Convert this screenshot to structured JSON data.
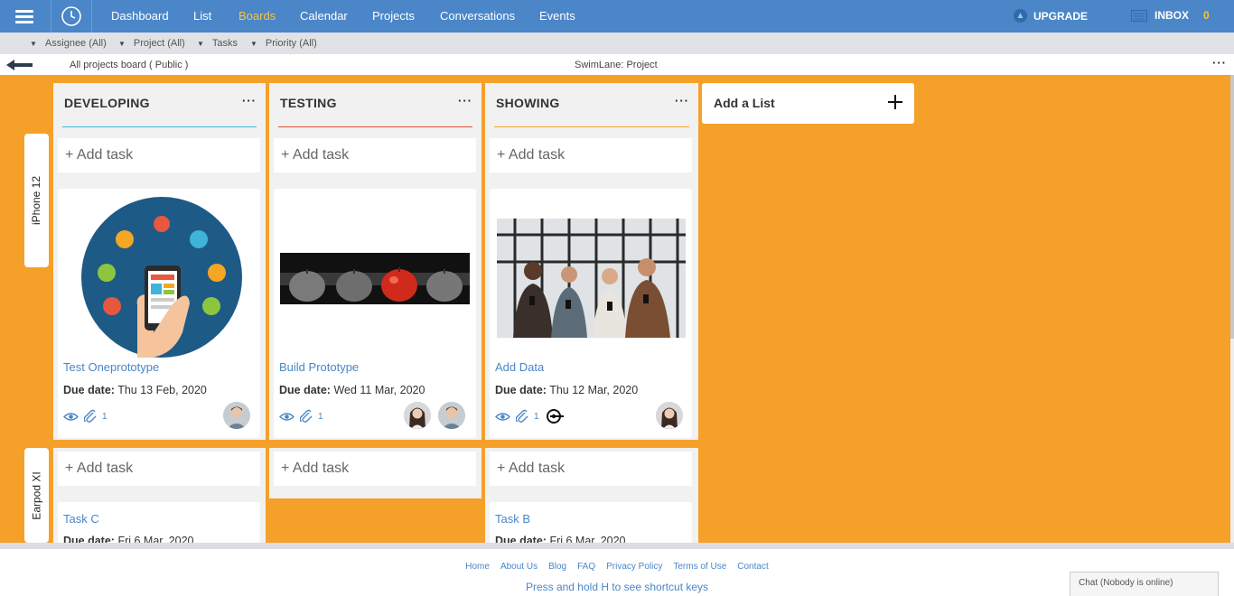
{
  "nav": {
    "items": [
      {
        "label": "Dashboard",
        "active": false
      },
      {
        "label": "List",
        "active": false
      },
      {
        "label": "Boards",
        "active": true
      },
      {
        "label": "Calendar",
        "active": false
      },
      {
        "label": "Projects",
        "active": false
      },
      {
        "label": "Conversations",
        "active": false
      },
      {
        "label": "Events",
        "active": false
      }
    ],
    "upgrade_label": "UPGRADE",
    "inbox_label": "INBOX",
    "inbox_count": "0",
    "accent_color": "#4a86c8",
    "active_color": "#f5c542"
  },
  "filters": [
    "Assignee (All)",
    "Project (All)",
    "Tasks",
    "Priority (All)"
  ],
  "board": {
    "title": "All projects board ( Public )",
    "swimlane_label": "SwimLane: Project",
    "more_label": "···",
    "background_color": "#f5a029"
  },
  "lanes": [
    "iPhone 12",
    "Earpod XI"
  ],
  "columns": [
    {
      "title": "DEVELOPING",
      "more": "···",
      "line_color": "#3fb3d8"
    },
    {
      "title": "TESTING",
      "more": "···",
      "line_color": "#d9533a"
    },
    {
      "title": "SHOWING",
      "more": "···",
      "line_color": "#f2a928"
    }
  ],
  "add_task_label": "+ Add task",
  "cards_lane1": [
    {
      "name": "Test Oneprototype",
      "due_label": "Due date:",
      "due_value": "Thu 13 Feb, 2020",
      "attachments": "1",
      "image": "mobile-apps-illustration"
    },
    {
      "name": "Build Prototype",
      "due_label": "Due date:",
      "due_value": "Wed 11 Mar, 2020",
      "attachments": "1",
      "image": "apples-photo"
    },
    {
      "name": "Add Data",
      "due_label": "Due date:",
      "due_value": "Thu 12 Mar, 2020",
      "attachments": "1",
      "image": "people-with-phones-photo"
    }
  ],
  "cards_lane2": [
    {
      "name": "Task C",
      "due_label": "Due date:",
      "due_value": "Fri 6 Mar, 2020"
    },
    {
      "name": "Task B",
      "due_label": "Due date:",
      "due_value": "Fri 6 Mar, 2020"
    }
  ],
  "add_list_label": "Add a List",
  "footer": {
    "links": [
      "Home",
      "About Us",
      "Blog",
      "FAQ",
      "Privacy Policy",
      "Terms of Use",
      "Contact"
    ],
    "shortcut_hint": "Press and hold H to see shortcut keys",
    "chat_label": "Chat (Nobody is online)"
  }
}
